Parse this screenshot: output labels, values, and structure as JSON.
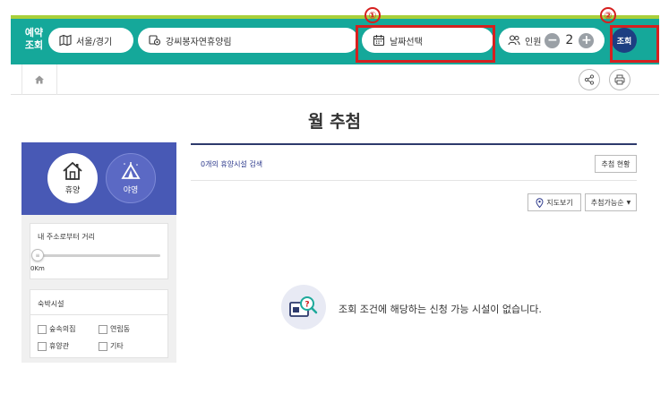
{
  "header": {
    "brand": "예약\n조회",
    "region": "서울/경기",
    "forest": "강씨봉자연휴양림",
    "date": "날짜선택",
    "people_label": "인원",
    "people_count": "2",
    "minus": "−",
    "plus": "+",
    "search": "조회",
    "markers": [
      "①",
      "②"
    ],
    "accent_color": "#15a89a",
    "highlight_color": "#d6201f"
  },
  "page": {
    "title": "월 추첨"
  },
  "sidebar": {
    "types": [
      {
        "label": "휴양",
        "icon": "house-icon",
        "selected": true
      },
      {
        "label": "야영",
        "icon": "tent-icon",
        "selected": false
      }
    ],
    "distance": {
      "title": "내 주소로부터 거리",
      "value": "0Km",
      "knob": "≡"
    },
    "accommodation": {
      "title": "숙박시설",
      "options": [
        "숲속의집",
        "연립동",
        "휴양관",
        "기타"
      ]
    }
  },
  "results": {
    "count_text": "0개의 휴양시설 검색",
    "status_button": "추첨 현황",
    "map_button": "지도보기",
    "sort_button": "추첨가능순",
    "sort_arrow": "▼",
    "empty_message": "조회 조건에 해당하는 신청 가능 시설이 없습니다."
  }
}
